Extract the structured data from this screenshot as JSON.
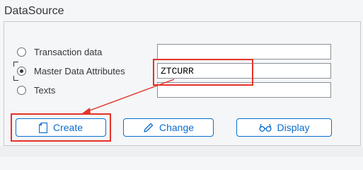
{
  "datasource": {
    "title": "DataSource",
    "options": [
      {
        "label": "Transaction data",
        "selected": false
      },
      {
        "label": "Master Data Attributes",
        "selected": true
      },
      {
        "label": "Texts",
        "selected": false
      }
    ],
    "fields": [
      {
        "value": ""
      },
      {
        "value": "ZTCURR"
      },
      {
        "value": ""
      }
    ]
  },
  "actions": {
    "create_label": "Create",
    "change_label": "Change",
    "display_label": "Display"
  },
  "colors": {
    "accent": "#0a6ed1",
    "highlight": "#e4332a"
  }
}
